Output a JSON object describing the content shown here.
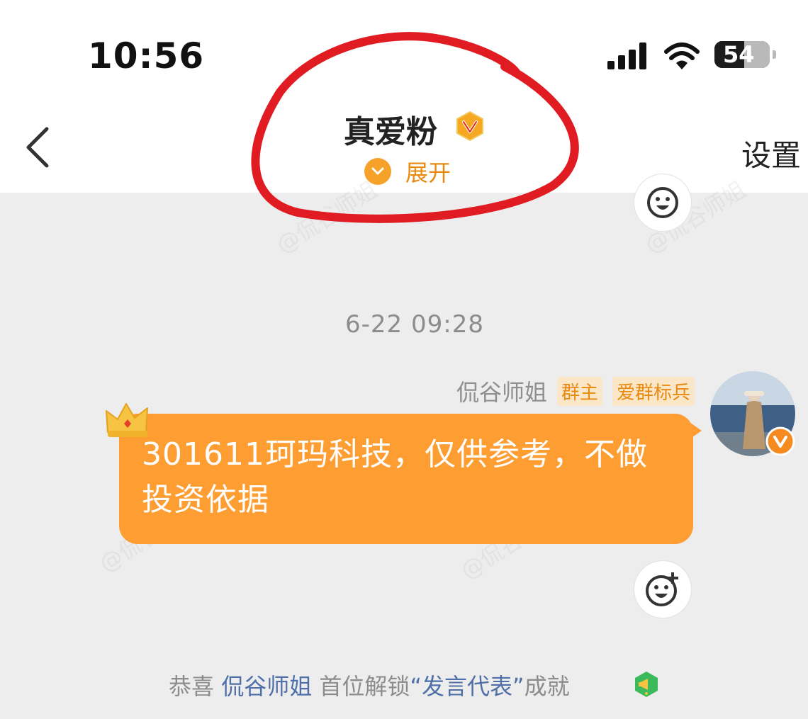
{
  "status_bar": {
    "time": "10:56",
    "battery": "54",
    "icons": [
      "signal-bars-icon",
      "wifi-icon",
      "battery-icon"
    ]
  },
  "header": {
    "title": "真爱粉",
    "expand_label": "展开",
    "settings_label": "设置",
    "icons": [
      "back-chevron-icon",
      "v-verified-badge-icon",
      "expand-chevron-circle-icon"
    ]
  },
  "chat": {
    "timestamp": "6-22 09:28",
    "watermark": "@侃谷师姐",
    "message": {
      "sender": "侃谷师姐",
      "tags": [
        "群主",
        "爱群标兵"
      ],
      "text": "301611珂玛科技，仅供参考，不做投资依据"
    },
    "notice": {
      "prefix": "恭喜 ",
      "user": "侃谷师姐",
      "middle": " 首位解锁",
      "achievement": "“发言代表”",
      "suffix": "成就"
    }
  },
  "colors": {
    "bubble": "#fd9d32",
    "accent_orange": "#e98a10",
    "annotation_red": "#e01b22",
    "link_blue": "#4f6fa8"
  }
}
